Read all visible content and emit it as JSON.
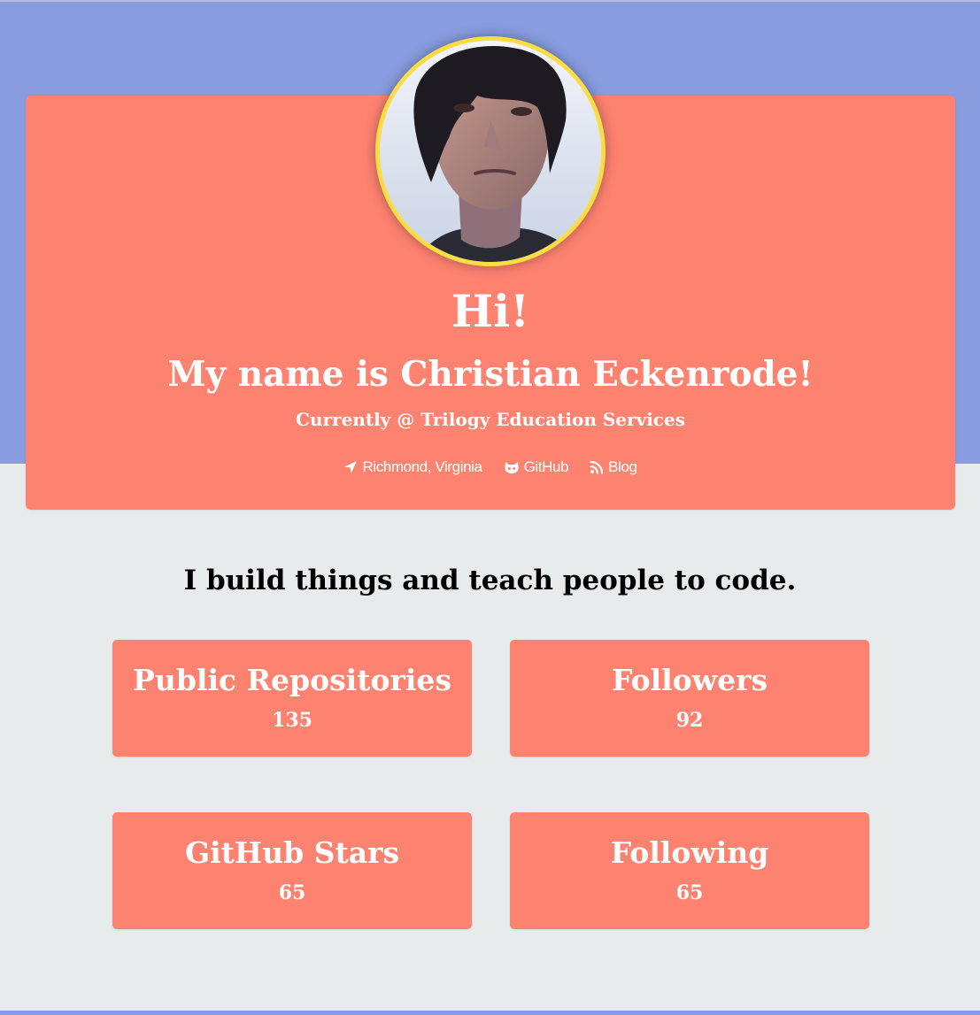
{
  "header": {
    "greeting": "Hi!",
    "name_line": "My name is Christian Eckenrode!",
    "company_line": "Currently @ Trilogy Education Services"
  },
  "links": [
    {
      "icon": "location-arrow-icon",
      "label": "Richmond, Virginia"
    },
    {
      "icon": "github-icon",
      "label": "GitHub"
    },
    {
      "icon": "rss-icon",
      "label": "Blog"
    }
  ],
  "tagline": "I build things and teach people to code.",
  "stats": {
    "repos": {
      "label": "Public Repositories",
      "value": "135"
    },
    "followers": {
      "label": "Followers",
      "value": "92"
    },
    "stars": {
      "label": "GitHub Stars",
      "value": "65"
    },
    "following": {
      "label": "Following",
      "value": "65"
    }
  },
  "colors": {
    "banner": "#889cdf",
    "card": "#fe8270",
    "avatar_ring": "#fadd45",
    "page_background": "#e8ebec"
  }
}
